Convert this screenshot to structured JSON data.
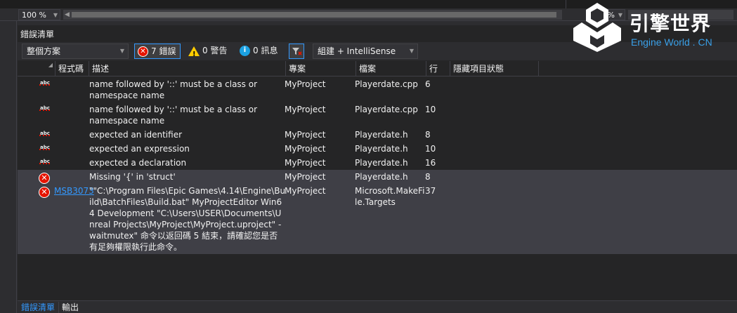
{
  "editor": {
    "zoom_left": "100 %",
    "zoom_right": "100 %"
  },
  "panel": {
    "title": "錯誤清單"
  },
  "toolbar": {
    "scope": "整個方案",
    "errors_label": "7 錯誤",
    "warnings_label": "0 警告",
    "messages_label": "0 訊息",
    "build_filter": "組建 + IntelliSense"
  },
  "columns": {
    "code": "程式碼",
    "description": "描述",
    "project": "專案",
    "file": "檔案",
    "line": "行",
    "suppression": "隱藏項目狀態"
  },
  "rows": [
    {
      "icon": "intellisense-error-icon",
      "code": "",
      "description": "name followed by '::' must be a class or namespace name",
      "project": "MyProject",
      "file": "Playerdate.cpp",
      "line": "6"
    },
    {
      "icon": "intellisense-error-icon",
      "code": "",
      "description": "name followed by '::' must be a class or namespace name",
      "project": "MyProject",
      "file": "Playerdate.cpp",
      "line": "10"
    },
    {
      "icon": "intellisense-error-icon",
      "code": "",
      "description": "expected an identifier",
      "project": "MyProject",
      "file": "Playerdate.h",
      "line": "8"
    },
    {
      "icon": "intellisense-error-icon",
      "code": "",
      "description": "expected an expression",
      "project": "MyProject",
      "file": "Playerdate.h",
      "line": "10"
    },
    {
      "icon": "intellisense-error-icon",
      "code": "",
      "description": "expected a declaration",
      "project": "MyProject",
      "file": "Playerdate.h",
      "line": "16"
    },
    {
      "icon": "build-error-icon",
      "code": "",
      "description": "Missing '{' in 'struct'",
      "project": "MyProject",
      "file": "Playerdate.h",
      "line": "8"
    },
    {
      "icon": "build-error-icon",
      "code": "MSB3073",
      "description": "\"\"C:\\Program Files\\Epic Games\\4.14\\Engine\\Build\\BatchFiles\\Build.bat\" MyProjectEditor Win64 Development \"C:\\Users\\USER\\Documents\\Unreal Projects\\MyProject\\MyProject.uproject\" -waitmutex\" 命令以返回碼 5 結束，請確認您是否有足夠權限執行此命令。",
      "project": "MyProject",
      "file": "Microsoft.MakeFile.Targets",
      "line": "37"
    }
  ],
  "bottom_tabs": {
    "errors": "錯誤清單",
    "output": "輸出"
  },
  "logo": {
    "cn": "引擎世界",
    "en": "Engine World . CN"
  },
  "colors": {
    "accent": "#3399ff",
    "error": "#e51400",
    "warning": "#ffcc00",
    "info": "#1ba1e2"
  }
}
